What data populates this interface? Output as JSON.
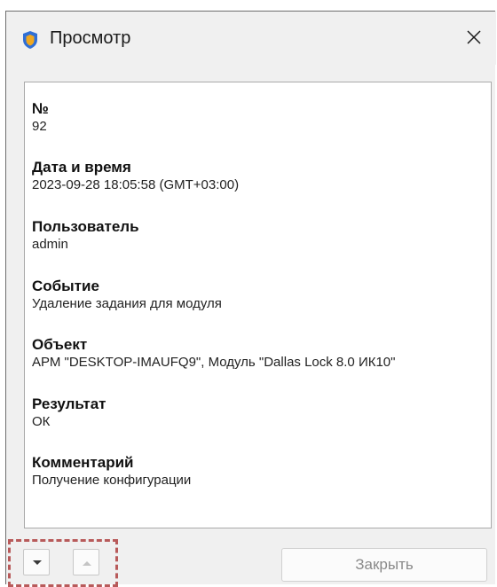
{
  "window": {
    "title": "Просмотр",
    "close_symbol": "✕"
  },
  "icons": {
    "app": "shield-icon",
    "close": "close-icon",
    "next": "chevron-down-icon",
    "previous": "chevron-up-icon"
  },
  "colors": {
    "shield_blue": "#2f6fd6",
    "shield_gold": "#f0a820",
    "highlight_dashes": "#b85a5a"
  },
  "fields": [
    {
      "label": "№",
      "value": "92"
    },
    {
      "label": "Дата и время",
      "value": "2023-09-28 18:05:58 (GMT+03:00)"
    },
    {
      "label": "Пользователь",
      "value": "admin"
    },
    {
      "label": "Событие",
      "value": "Удаление задания для модуля"
    },
    {
      "label": "Объект",
      "value": "АРМ \"DESKTOP-IMAUFQ9\", Модуль \"Dallas Lock 8.0 ИК10\""
    },
    {
      "label": "Результат",
      "value": "ОК"
    },
    {
      "label": "Комментарий",
      "value": "Получение конфигурации"
    }
  ],
  "buttons": {
    "close_label": "Закрыть"
  }
}
